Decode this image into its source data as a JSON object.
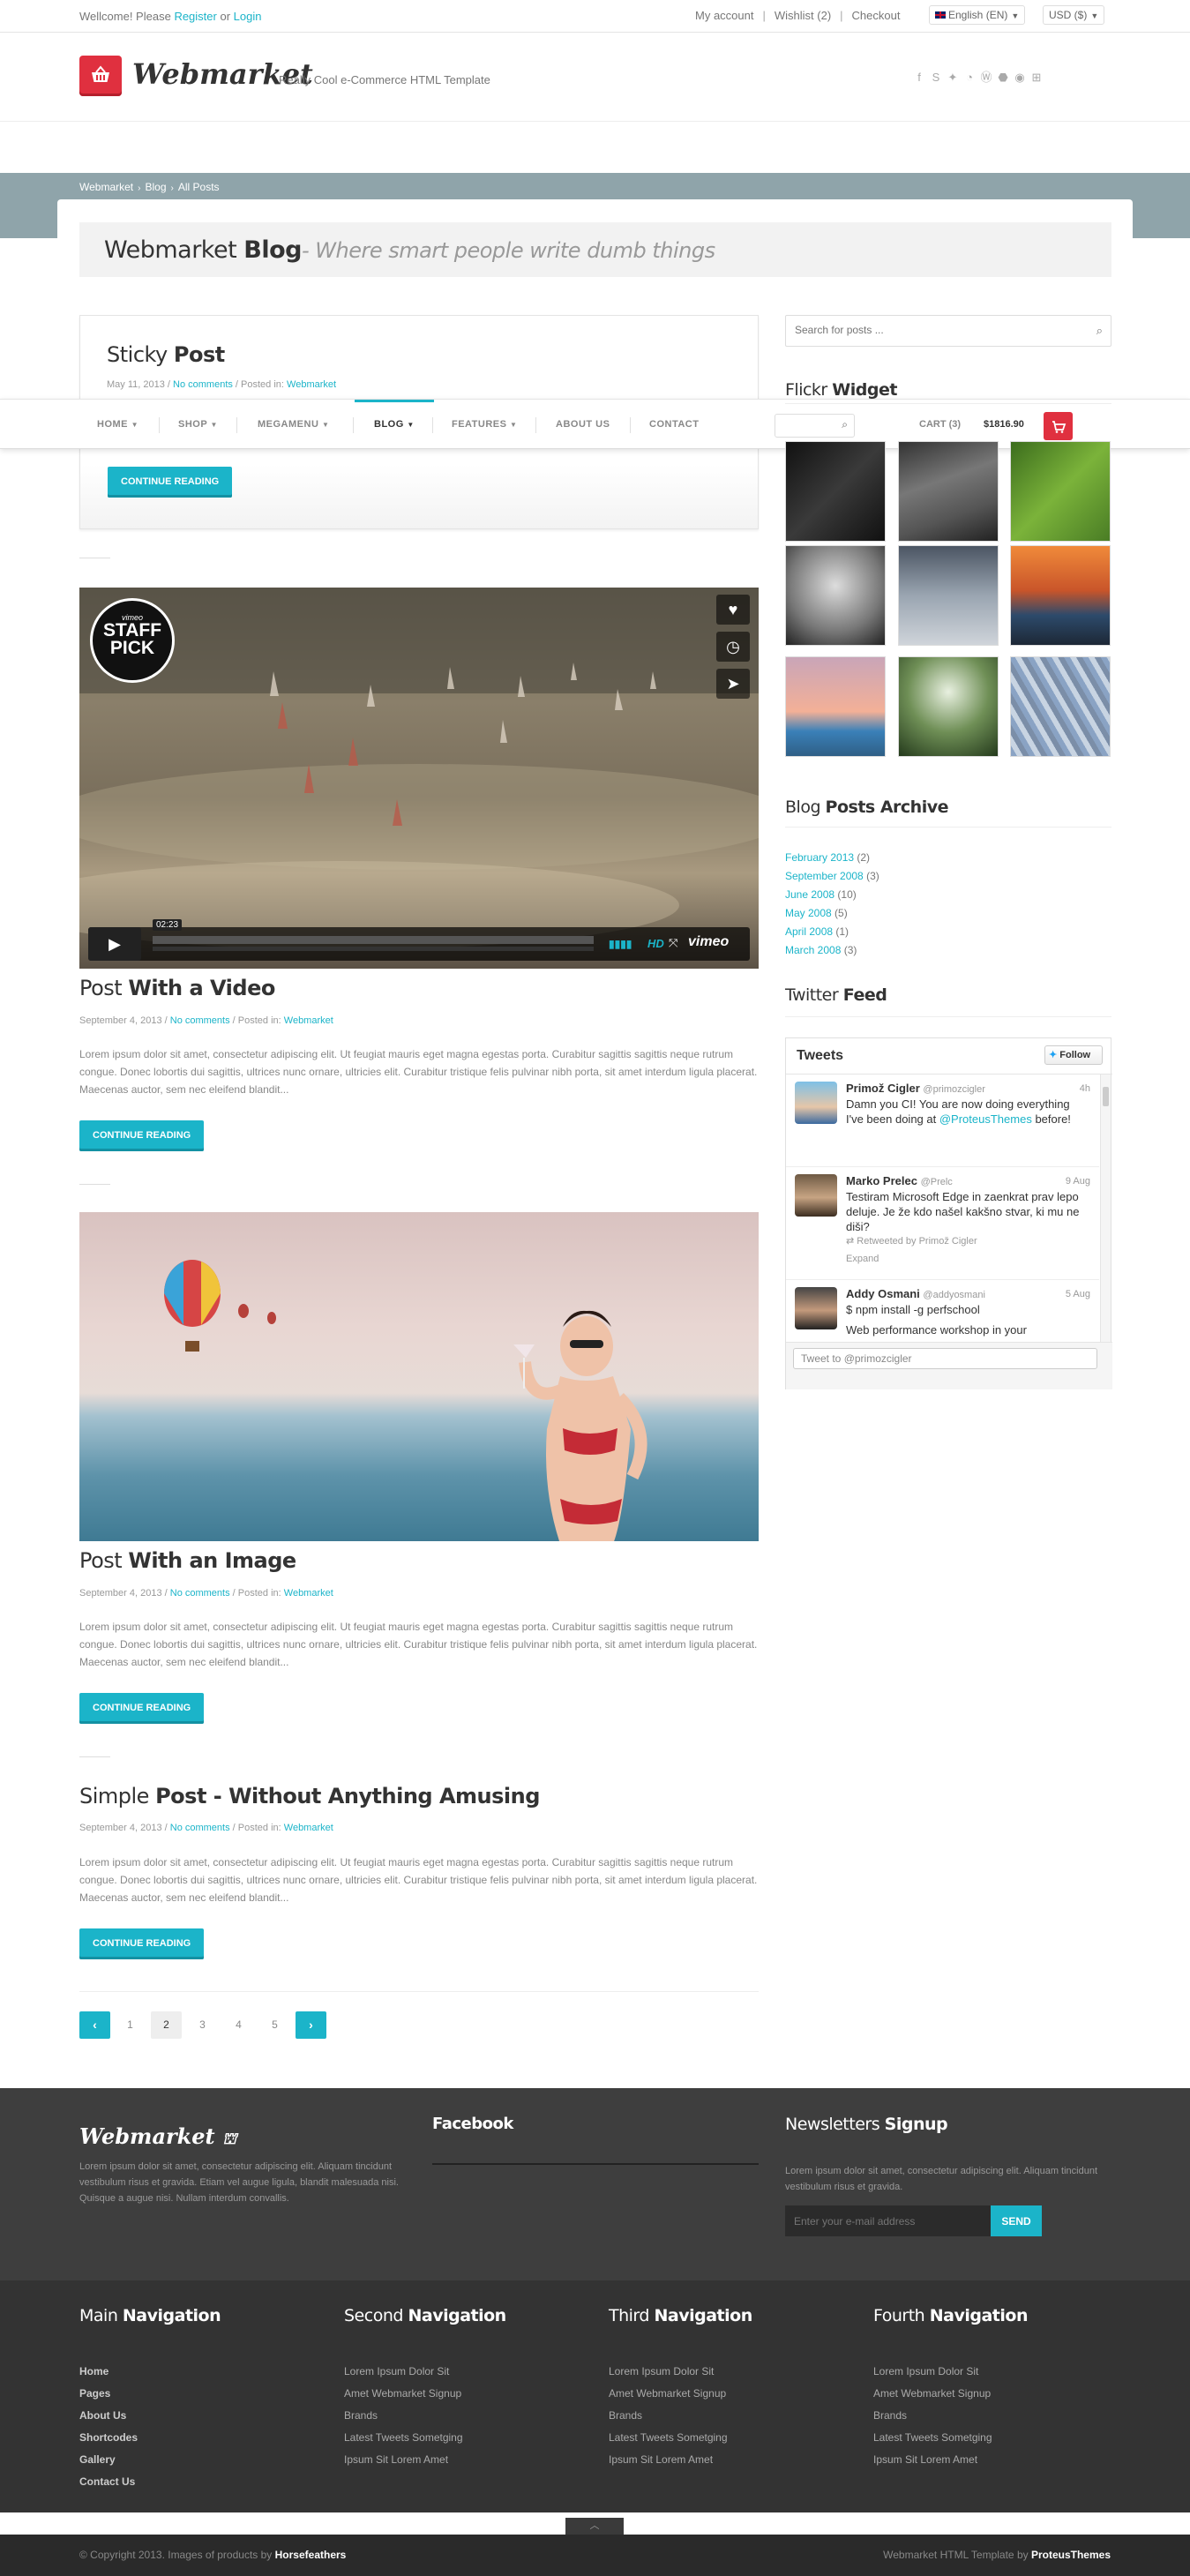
{
  "topbar": {
    "welcome_prefix": "Wellcome! Please",
    "register_label": "Register",
    "or_text": "or",
    "login_label": "Login",
    "links": [
      "My account",
      "Wishlist (2)",
      "Checkout"
    ],
    "language": "English (EN)",
    "currency": "USD ($)"
  },
  "header": {
    "logo_text": "Webmarket",
    "tagline": "Really Cool e-Commerce HTML Template",
    "social_icons": [
      "facebook-icon",
      "skype-icon",
      "twitter-icon",
      "rss-icon",
      "wordpress-icon",
      "android-icon",
      "apple-icon",
      "windows-icon"
    ]
  },
  "breadcrumb": [
    "Webmarket",
    "Blog",
    "All Posts"
  ],
  "page_title": {
    "prefix": "Webmarket ",
    "bold": "Blog",
    "subtitle": "- Where smart people write dumb things"
  },
  "nav": {
    "items": [
      "HOME",
      "SHOP",
      "MEGAMENU",
      "BLOG",
      "FEATURES",
      "ABOUT US",
      "CONTACT"
    ],
    "active": "BLOG",
    "cart_label": "CART (3)",
    "cart_total": "$1816.90"
  },
  "posts": {
    "sticky": {
      "title_plain": "Sticky ",
      "title_bold": "Post",
      "date": "May 11, 2013",
      "comments": "No comments",
      "posted_in": "Posted in:",
      "category": "Webmarket",
      "button": "CONTINUE READING"
    },
    "video": {
      "title_plain": "Post ",
      "title_bold": "With a Video",
      "date": "September 4, 2013",
      "comments": "No comments",
      "posted_in": "Posted in:",
      "category": "Webmarket",
      "excerpt": "Lorem ipsum dolor sit amet, consectetur adipiscing elit. Ut feugiat mauris eget magna egestas porta. Curabitur sagittis sagittis neque rutrum congue. Donec lobortis dui sagittis, ultrices nunc ornare, ultricies elit. Curabitur tristique felis pulvinar nibh porta, sit amet interdum ligula placerat. Maecenas auctor, sem nec eleifend blandit...",
      "button": "CONTINUE READING",
      "badge_top": "vimeo",
      "badge_line1": "STAFF",
      "badge_line2": "PICK",
      "time": "02:23",
      "hd_label": "HD",
      "brand": "vimeo"
    },
    "image": {
      "title_plain": "Post ",
      "title_bold": "With an Image",
      "date": "September 4, 2013",
      "comments": "No comments",
      "posted_in": "Posted in:",
      "category": "Webmarket",
      "excerpt": "Lorem ipsum dolor sit amet, consectetur adipiscing elit. Ut feugiat mauris eget magna egestas porta. Curabitur sagittis sagittis neque rutrum congue. Donec lobortis dui sagittis, ultrices nunc ornare, ultricies elit. Curabitur tristique felis pulvinar nibh porta, sit amet interdum ligula placerat. Maecenas auctor, sem nec eleifend blandit...",
      "button": "CONTINUE READING"
    },
    "simple": {
      "title_plain": "Simple ",
      "title_bold": "Post - Without Anything Amusing",
      "date": "September 4, 2013",
      "comments": "No comments",
      "posted_in": "Posted in:",
      "category": "Webmarket",
      "excerpt": "Lorem ipsum dolor sit amet, consectetur adipiscing elit. Ut feugiat mauris eget magna egestas porta. Curabitur sagittis sagittis neque rutrum congue. Donec lobortis dui sagittis, ultrices nunc ornare, ultricies elit. Curabitur tristique felis pulvinar nibh porta, sit amet interdum ligula placerat. Maecenas auctor, sem nec eleifend blandit...",
      "button": "CONTINUE READING"
    }
  },
  "pagination": {
    "pages": [
      "1",
      "2",
      "3",
      "4",
      "5"
    ],
    "current": "2"
  },
  "sidebar": {
    "search_placeholder": "Search for posts ...",
    "flickr_title_plain": "Flickr ",
    "flickr_title_bold": "Widget",
    "archive_title_plain": "Blog ",
    "archive_title_bold": "Posts Archive",
    "archive": [
      {
        "month": "February 2013",
        "count": "(2)"
      },
      {
        "month": "September 2008",
        "count": "(3)"
      },
      {
        "month": "June 2008",
        "count": "(10)"
      },
      {
        "month": "May 2008",
        "count": "(5)"
      },
      {
        "month": "April 2008",
        "count": "(1)"
      },
      {
        "month": "March 2008",
        "count": "(3)"
      }
    ],
    "twitter_title_plain": "Twitter ",
    "twitter_title_bold": "Feed",
    "tweets_header": "Tweets",
    "follow_label": "Follow",
    "tweets": [
      {
        "name": "Primož Cigler",
        "handle": "@primozcigler",
        "time": "4h",
        "text": "Damn you CI! You are now doing everything I've been doing at",
        "mention": "@ProteusThemes",
        "text_end": " before!"
      },
      {
        "name": "Marko Prelec",
        "handle": "@Prelc",
        "time": "9 Aug",
        "text": "Testiram Microsoft Edge in zaenkrat prav lepo deluje. Je že kdo našel kakšno stvar, ki mu ne diši?",
        "retweet": "Retweeted by Primož Cigler",
        "expand": "Expand"
      },
      {
        "name": "Addy Osmani",
        "handle": "@addyosmani",
        "time": "5 Aug",
        "text": "$ npm install -g perfschool",
        "text2": "Web performance workshop in your"
      }
    ],
    "tweet_to": "Tweet to @primozcigler"
  },
  "footer": {
    "logo_text": "Webmarket",
    "about": "Lorem ipsum dolor sit amet, consectetur adipiscing elit. Aliquam tincidunt vestibulum risus et gravida. Etiam vel augue ligula, blandit malesuada nisi. Quisque a augue nisi. Nullam interdum convallis.",
    "facebook_title": "Facebook",
    "newsletter_title_plain": "Newsletters ",
    "newsletter_title_bold": "Signup",
    "newsletter_text": "Lorem ipsum dolor sit amet, consectetur adipiscing elit. Aliquam tincidunt vestibulum risus et gravida.",
    "newsletter_placeholder": "Enter your e-mail address",
    "send_label": "SEND",
    "columns": [
      {
        "title_plain": "Main ",
        "title_bold": "Navigation",
        "items": [
          "Home",
          "Pages",
          "About Us",
          "Shortcodes",
          "Gallery",
          "Contact Us"
        ]
      },
      {
        "title_plain": "Second ",
        "title_bold": "Navigation",
        "items": [
          "Lorem Ipsum Dolor Sit",
          "Amet Webmarket Signup",
          "Brands",
          "Latest Tweets Sometging",
          "Ipsum Sit Lorem Amet"
        ]
      },
      {
        "title_plain": "Third ",
        "title_bold": "Navigation",
        "items": [
          "Lorem Ipsum Dolor Sit",
          "Amet Webmarket Signup",
          "Brands",
          "Latest Tweets Sometging",
          "Ipsum Sit Lorem Amet"
        ]
      },
      {
        "title_plain": "Fourth ",
        "title_bold": "Navigation",
        "items": [
          "Lorem Ipsum Dolor Sit",
          "Amet Webmarket Signup",
          "Brands",
          "Latest Tweets Sometging",
          "Ipsum Sit Lorem Amet"
        ]
      }
    ],
    "copyright_prefix": "© Copyright 2013. Images of products by",
    "copyright_brand": "Horsefeathers",
    "credit_prefix": "Webmarket HTML Template by",
    "credit_brand": "ProteusThemes"
  },
  "colors": {
    "accent": "#1bb4c9",
    "brand_red": "#e0303f",
    "band": "#8fa4aa",
    "footer": "#3e3e3e"
  }
}
